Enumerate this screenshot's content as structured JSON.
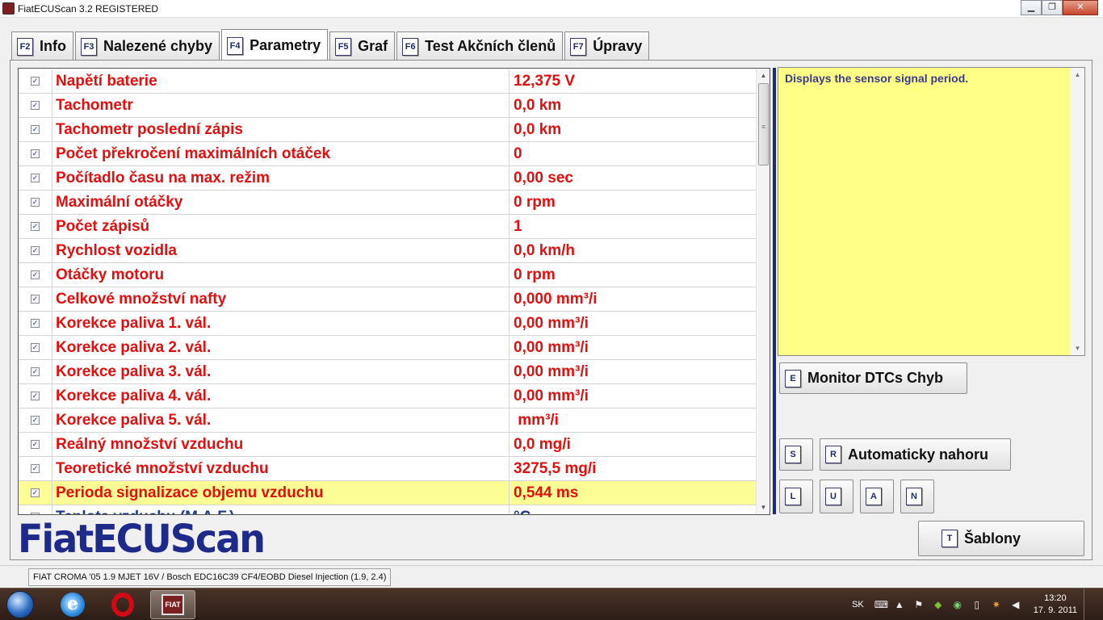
{
  "window": {
    "title": "FiatECUScan 3.2 REGISTERED",
    "min_glyph": "▁",
    "max_glyph": "❐",
    "close_glyph": "✕"
  },
  "tabs": [
    {
      "key": "F2",
      "label": "Info"
    },
    {
      "key": "F3",
      "label": "Nalezené chyby"
    },
    {
      "key": "F4",
      "label": "Parametry"
    },
    {
      "key": "F5",
      "label": "Graf"
    },
    {
      "key": "F6",
      "label": "Test Akčních členů"
    },
    {
      "key": "F7",
      "label": "Úpravy"
    }
  ],
  "active_tab": "Parametry",
  "params": [
    {
      "name": "Napětí baterie",
      "value": "12,375 V",
      "checked": true
    },
    {
      "name": "Tachometr",
      "value": "0,0 km",
      "checked": true
    },
    {
      "name": "Tachometr poslední zápis",
      "value": "0,0 km",
      "checked": true
    },
    {
      "name": "Počet překročení maximálních otáček",
      "value": "0",
      "checked": true
    },
    {
      "name": "Počítadlo času na max. režim",
      "value": "0,00 sec",
      "checked": true
    },
    {
      "name": "Maximální otáčky",
      "value": "0 rpm",
      "checked": true
    },
    {
      "name": "Počet zápisů",
      "value": "1",
      "checked": true
    },
    {
      "name": "Rychlost vozidla",
      "value": "0,0 km/h",
      "checked": true
    },
    {
      "name": "Otáčky motoru",
      "value": "0 rpm",
      "checked": true
    },
    {
      "name": "Celkové množství nafty",
      "value": "0,000 mm³/i",
      "checked": true
    },
    {
      "name": "Korekce paliva 1. vál.",
      "value": "0,00 mm³/i",
      "checked": true
    },
    {
      "name": "Korekce paliva 2. vál.",
      "value": "0,00 mm³/i",
      "checked": true
    },
    {
      "name": "Korekce paliva 3. vál.",
      "value": "0,00 mm³/i",
      "checked": true
    },
    {
      "name": "Korekce paliva 4. vál.",
      "value": "0,00 mm³/i",
      "checked": true
    },
    {
      "name": "Korekce paliva 5. vál.",
      "value": " mm³/i",
      "checked": true
    },
    {
      "name": "Reálný množství vzduchu",
      "value": "0,0 mg/i",
      "checked": true
    },
    {
      "name": "Teoretické množství vzduchu",
      "value": "3275,5 mg/i",
      "checked": true
    },
    {
      "name": "Perioda signalizace objemu vzduchu",
      "value": "0,544 ms",
      "checked": true,
      "highlighted": true
    },
    {
      "name": "Teplota vzduchu (M.A.F.)",
      "value": "°C",
      "checked": false,
      "partial": true
    }
  ],
  "check_glyph": "✓",
  "info_text": "Displays the sensor signal period.",
  "buttons": {
    "monitor": {
      "key": "E",
      "label": "Monitor DTCs Chyb"
    },
    "s": {
      "key": "S"
    },
    "auto": {
      "key": "R",
      "label": "Automaticky nahoru"
    },
    "l": {
      "key": "L"
    },
    "u": {
      "key": "U"
    },
    "a": {
      "key": "A"
    },
    "n": {
      "key": "N"
    },
    "sablony": {
      "key": "T",
      "label": "Šablony"
    }
  },
  "logo_text": "FiatECUScan",
  "status_text": "FIAT CROMA '05 1.9 MJET 16V / Bosch EDC16C39 CF4/EOBD Diesel Injection (1.9, 2.4)",
  "taskbar": {
    "lang": "SK",
    "time": "13:20",
    "date": "17. 9. 2011",
    "ie_glyph": "e",
    "fiat_glyph": "FIAT"
  },
  "tray_icons": [
    "keyboard-icon",
    "network-icon",
    "flag-icon",
    "nvidia-icon",
    "update-icon",
    "battery-icon",
    "power-icon",
    "volume-icon"
  ]
}
